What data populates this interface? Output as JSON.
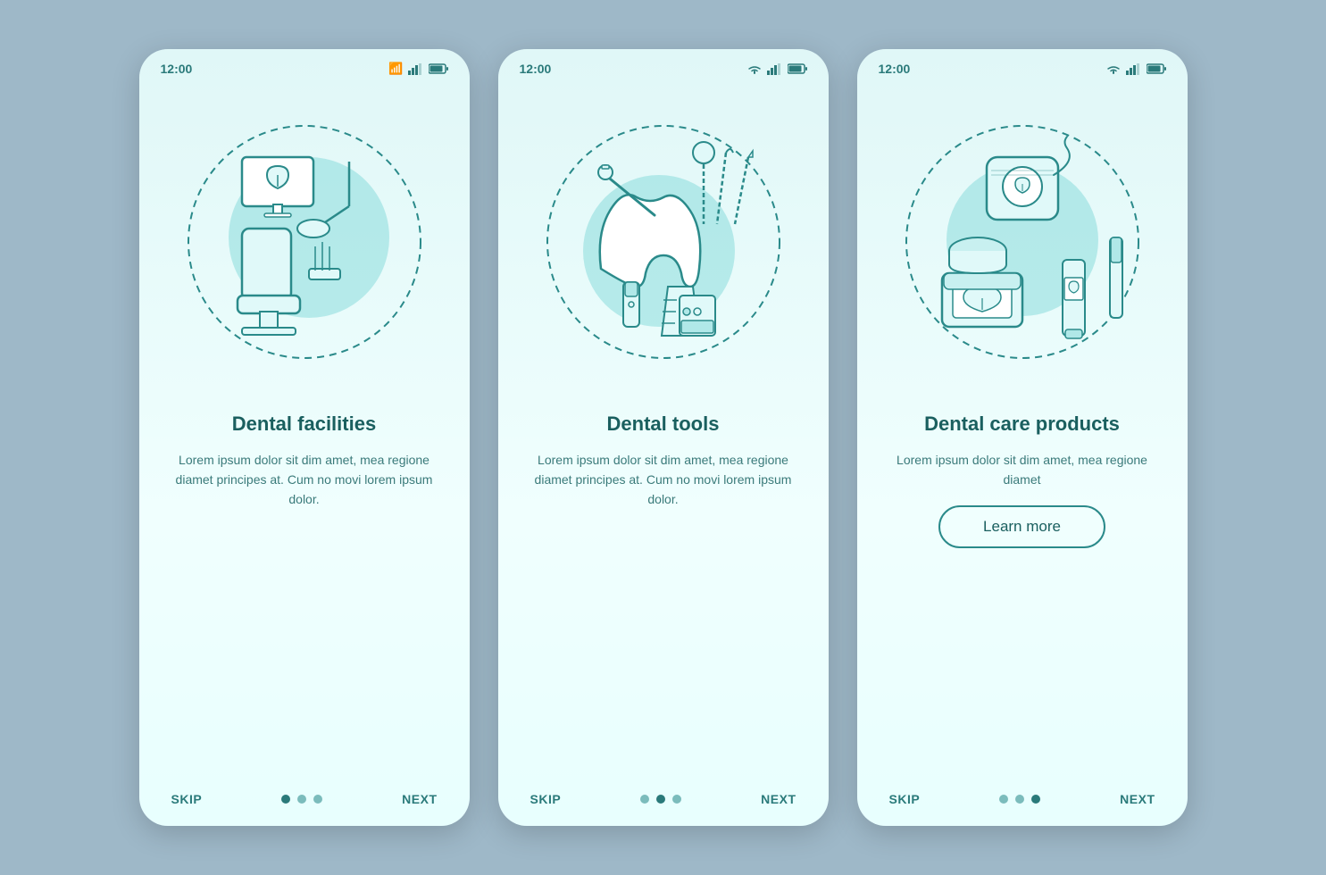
{
  "background_color": "#9eb8c8",
  "screens": [
    {
      "id": "screen1",
      "time": "12:00",
      "title": "Dental facilities",
      "body": "Lorem ipsum dolor sit dim amet, mea regione diamet principes at. Cum no movi lorem ipsum dolor.",
      "has_learn_more": false,
      "dots": [
        true,
        false,
        false
      ],
      "skip_label": "SKIP",
      "next_label": "NEXT"
    },
    {
      "id": "screen2",
      "time": "12:00",
      "title": "Dental tools",
      "body": "Lorem ipsum dolor sit dim amet, mea regione diamet principes at. Cum no movi lorem ipsum dolor.",
      "has_learn_more": false,
      "dots": [
        false,
        true,
        false
      ],
      "skip_label": "SKIP",
      "next_label": "NEXT"
    },
    {
      "id": "screen3",
      "time": "12:00",
      "title": "Dental care products",
      "body": "Lorem ipsum dolor sit dim amet, mea regione diamet",
      "has_learn_more": true,
      "learn_more_label": "Learn more",
      "dots": [
        false,
        false,
        true
      ],
      "skip_label": "SKIP",
      "next_label": "NEXT"
    }
  ]
}
